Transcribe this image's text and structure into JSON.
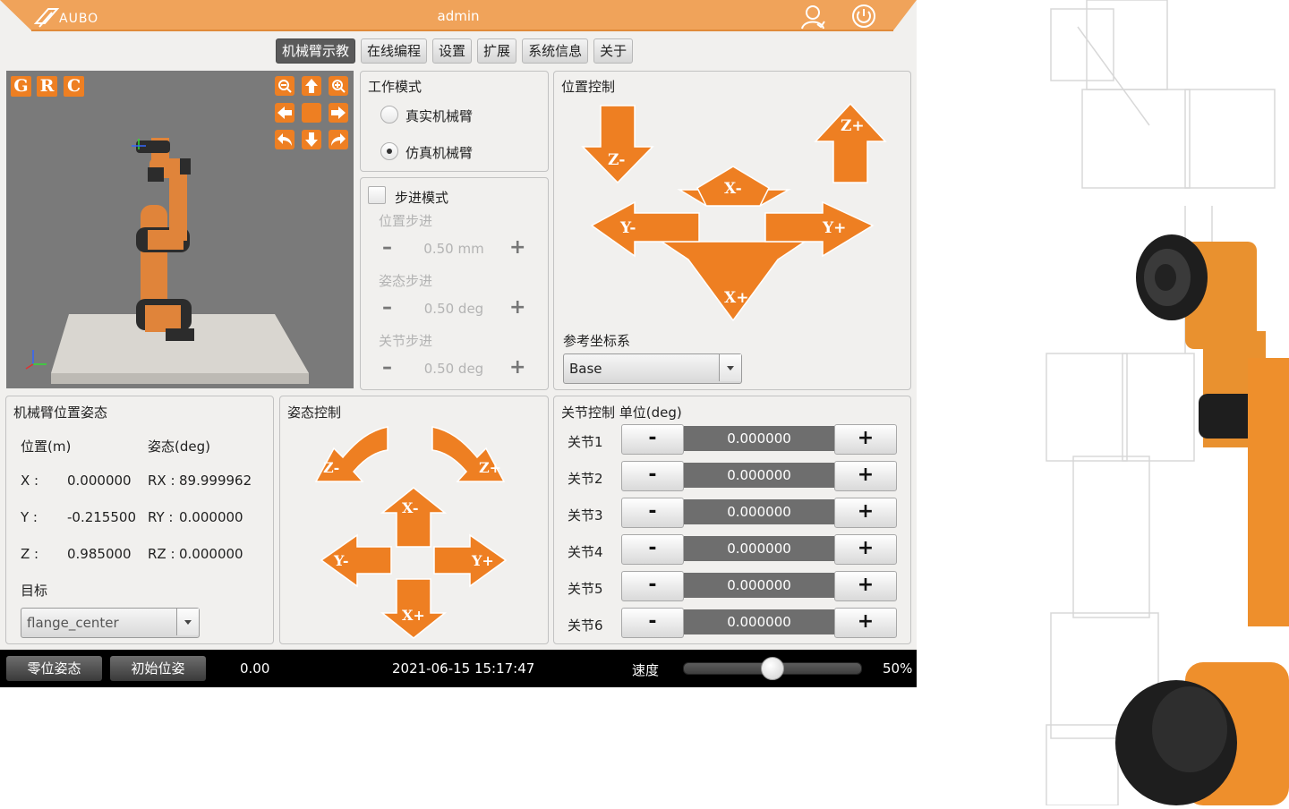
{
  "app": {
    "logo": "AUBO",
    "title": "admin"
  },
  "icons": {
    "user": "user-icon",
    "power": "power-icon"
  },
  "tabs": [
    {
      "label": "机械臂示教",
      "active": true
    },
    {
      "label": "在线编程"
    },
    {
      "label": "设置"
    },
    {
      "label": "扩展"
    },
    {
      "label": "系统信息"
    },
    {
      "label": "关于"
    }
  ],
  "viewport": {
    "buttons": [
      "G",
      "R",
      "C"
    ]
  },
  "work_mode": {
    "title": "工作模式",
    "options": [
      {
        "label": "真实机械臂",
        "selected": false
      },
      {
        "label": "仿真机械臂",
        "selected": true
      }
    ]
  },
  "step_mode": {
    "label": "步进模式",
    "checked": false,
    "position_label": "位置步进",
    "position_value": "0.50 mm",
    "attitude_label": "姿态步进",
    "attitude_value": "0.50 deg",
    "joint_label": "关节步进",
    "joint_value": "0.50 deg"
  },
  "position_control": {
    "title": "位置控制",
    "arrows": {
      "z_minus": "Z-",
      "z_plus": "Z+",
      "x_minus": "X-",
      "x_plus": "X+",
      "y_minus": "Y-",
      "y_plus": "Y+"
    },
    "ref_label": "参考坐标系",
    "ref_value": "Base"
  },
  "pose": {
    "title": "机械臂位置姿态",
    "pos_header": "位置(m)",
    "att_header": "姿态(deg)",
    "x_label": "X :",
    "x": "0.000000",
    "y_label": "Y :",
    "y": "-0.215500",
    "z_label": "Z :",
    "z": "0.985000",
    "rx_label": "RX :",
    "rx": "89.999962",
    "ry_label": "RY :",
    "ry": "0.000000",
    "rz_label": "RZ :",
    "rz": "0.000000",
    "target_label": "目标",
    "target_value": "flange_center"
  },
  "attitude_control": {
    "title": "姿态控制",
    "arrows": {
      "z_minus": "Z-",
      "z_plus": "Z+",
      "x_minus": "X-",
      "x_plus": "X+",
      "y_minus": "Y-",
      "y_plus": "Y+"
    }
  },
  "joint_control": {
    "title": "关节控制 单位(deg)",
    "minus": "-",
    "plus": "+",
    "joints": [
      {
        "label": "关节1",
        "value": "0.000000"
      },
      {
        "label": "关节2",
        "value": "0.000000"
      },
      {
        "label": "关节3",
        "value": "0.000000"
      },
      {
        "label": "关节4",
        "value": "0.000000"
      },
      {
        "label": "关节5",
        "value": "0.000000"
      },
      {
        "label": "关节6",
        "value": "0.000000"
      }
    ]
  },
  "status": {
    "zero_pose": "零位姿态",
    "init_pose": "初始位姿",
    "value": "0.00",
    "datetime": "2021-06-15 15:17:47",
    "speed_label": "速度",
    "speed_percent": "50%",
    "speed_fraction": 0.5
  },
  "colors": {
    "accent": "#ee7f22",
    "titlebar": "#f0a35a",
    "statusbar": "#000000"
  }
}
